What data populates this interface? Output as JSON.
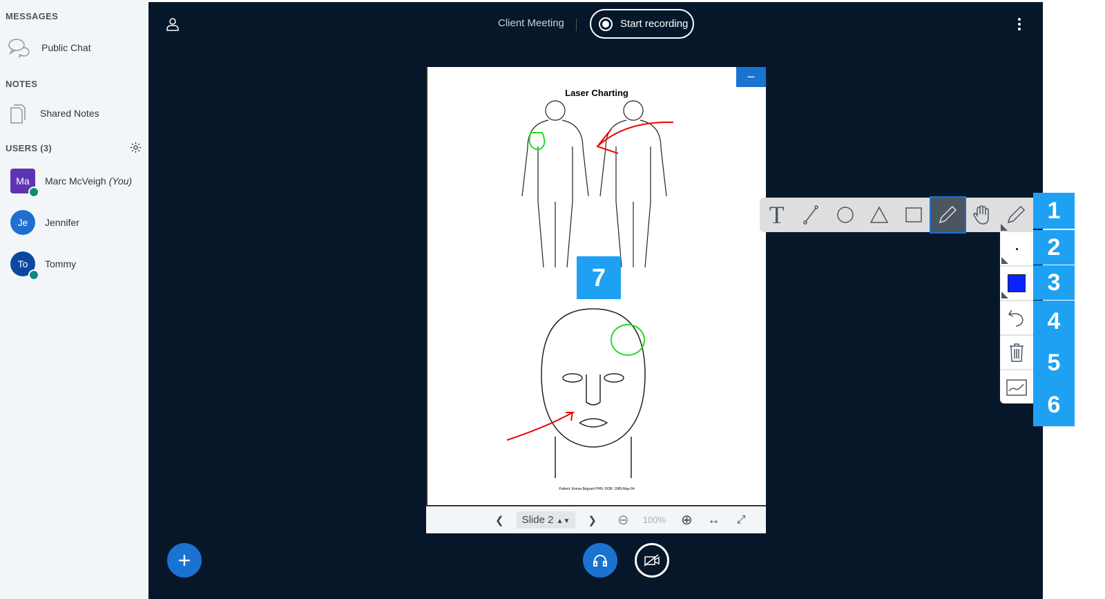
{
  "sidebar": {
    "messages_heading": "MESSAGES",
    "public_chat": "Public Chat",
    "notes_heading": "NOTES",
    "shared_notes": "Shared Notes",
    "users_heading": "USERS (3)",
    "users": [
      {
        "initials": "Ma",
        "name": "Marc McVeigh",
        "suffix": "(You)",
        "color": "#5e35b1"
      },
      {
        "initials": "Je",
        "name": "Jennifer",
        "color": "#1e6fd0"
      },
      {
        "initials": "To",
        "name": "Tommy",
        "color": "#0d47a1"
      }
    ]
  },
  "header": {
    "title": "Client Meeting",
    "record_label": "Start recording"
  },
  "slide": {
    "title": "Laser Charting",
    "footer": "Patient: Emma Begrani  PHN:  DOB: 1985-May-04",
    "minimize": "–"
  },
  "controls": {
    "slide_select": "Slide 2",
    "zoom": "100%"
  },
  "annotations": {
    "labels": [
      "1",
      "2",
      "3",
      "4",
      "5",
      "6",
      "7"
    ],
    "accent": "#1ea1f2"
  },
  "toolbar": {
    "tools": [
      "text",
      "line",
      "ellipse",
      "triangle",
      "rectangle",
      "pencil",
      "hand",
      "pencil-menu"
    ],
    "active": "pencil",
    "color": "#0a22ff"
  }
}
